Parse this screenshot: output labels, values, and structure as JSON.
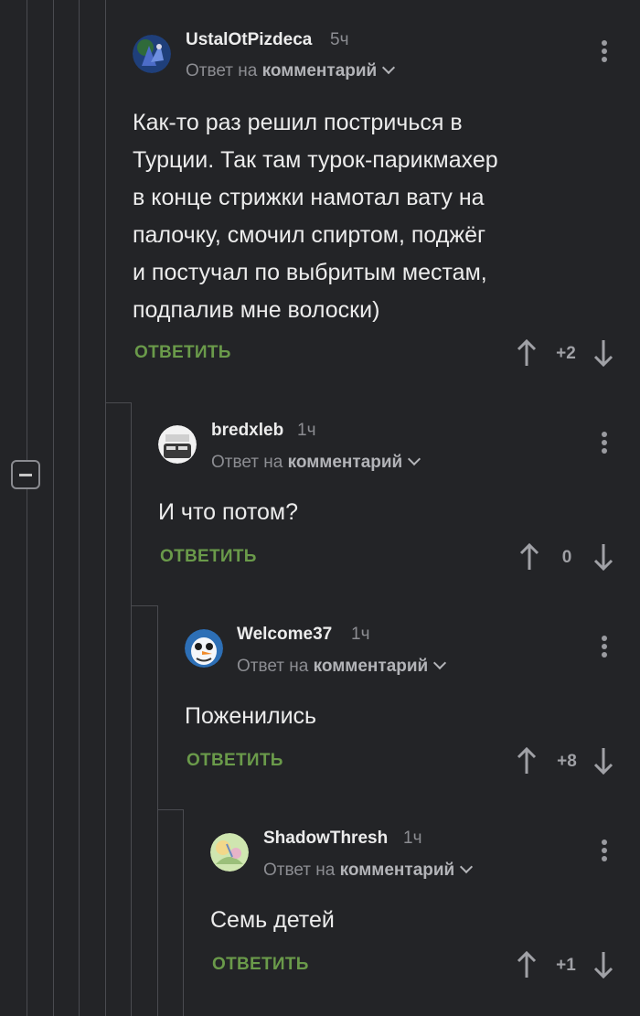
{
  "comments": [
    {
      "username": "UstalOtPizdeca",
      "time": "5ч",
      "reply_prefix": "Ответ на",
      "reply_target": "комментарий",
      "text_lines": [
        "Как-то раз решил постричься в",
        "Турции. Так там турок-парикмахер",
        "в конце стрижки намотал вату на",
        "палочку, смочил спиртом, поджёг",
        "и постучал по выбритым местам,",
        "подпалив мне волоски)"
      ],
      "reply_label": "ОТВЕТИТЬ",
      "score": "+2"
    },
    {
      "username": "bredxleb",
      "time": "1ч",
      "reply_prefix": "Ответ на",
      "reply_target": "комментарий",
      "text_lines": [
        "И что потом?"
      ],
      "reply_label": "ОТВЕТИТЬ",
      "score": "0"
    },
    {
      "username": "Welcome37",
      "time": "1ч",
      "reply_prefix": "Ответ на",
      "reply_target": "комментарий",
      "text_lines": [
        "Поженились"
      ],
      "reply_label": "ОТВЕТИТЬ",
      "score": "+8"
    },
    {
      "username": "ShadowThresh",
      "time": "1ч",
      "reply_prefix": "Ответ на",
      "reply_target": "комментарий",
      "text_lines": [
        "Семь детей"
      ],
      "reply_label": "ОТВЕТИТЬ",
      "score": "+1"
    }
  ],
  "icons": {
    "upvote": "arrow-up-icon",
    "downvote": "arrow-down-icon",
    "menu": "more-vertical-icon",
    "expand": "chevron-down-icon",
    "collapse": "minus-icon"
  },
  "colors": {
    "background": "#232427",
    "reply_button": "#6a9a4a",
    "thread_line": "#4a4b50"
  }
}
